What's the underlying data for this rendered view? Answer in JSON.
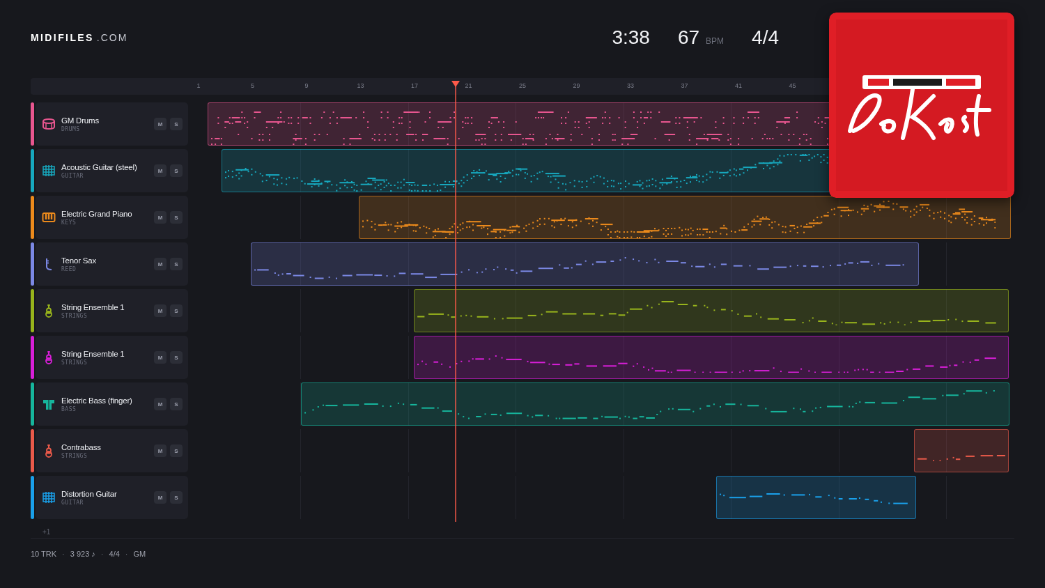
{
  "logo": {
    "name": "MIDIFILES",
    "suffix": ".COM"
  },
  "stats": {
    "duration": "3:38",
    "tempo": "67",
    "tempo_unit": "BPM",
    "meter": "4/4"
  },
  "ruler": {
    "ticks": [
      "1",
      "5",
      "9",
      "13",
      "17",
      "21",
      "25",
      "29",
      "33",
      "37",
      "41",
      "45"
    ]
  },
  "playhead": {
    "level": 0.324
  },
  "tracks": [
    {
      "name": "GM Drums",
      "category": "DRUMS",
      "color": "#e8568f",
      "kind": "drums",
      "mute": "M",
      "solo": "S"
    },
    {
      "name": "Acoustic Guitar (steel)",
      "category": "GUITAR",
      "color": "#17a8be",
      "kind": "guitar",
      "mute": "M",
      "solo": "S"
    },
    {
      "name": "Electric Grand Piano",
      "category": "KEYS",
      "color": "#ec8a1c",
      "kind": "keys",
      "mute": "M",
      "solo": "S"
    },
    {
      "name": "Tenor Sax",
      "category": "REED",
      "color": "#7b88e4",
      "kind": "reed",
      "mute": "M",
      "solo": "S"
    },
    {
      "name": "String Ensemble 1",
      "category": "STRINGS",
      "color": "#98b41c",
      "kind": "strings",
      "mute": "M",
      "solo": "S"
    },
    {
      "name": "String Ensemble 1",
      "category": "STRINGS",
      "color": "#d81fd8",
      "kind": "strings",
      "mute": "M",
      "solo": "S"
    },
    {
      "name": "Electric Bass (finger)",
      "category": "BASS",
      "color": "#16b59c",
      "kind": "bass",
      "mute": "M",
      "solo": "S"
    },
    {
      "name": "Contrabass",
      "category": "STRINGS",
      "color": "#ea5a4a",
      "kind": "strings",
      "mute": "M",
      "solo": "S"
    },
    {
      "name": "Distortion Guitar",
      "category": "GUITAR",
      "color": "#1aa0ea",
      "kind": "guitar",
      "mute": "M",
      "solo": "S"
    }
  ],
  "more_tracks": "+1",
  "footer": [
    "10 TRK",
    "·",
    "3 923 ♪",
    "·",
    "4/4",
    "·",
    "GM"
  ]
}
